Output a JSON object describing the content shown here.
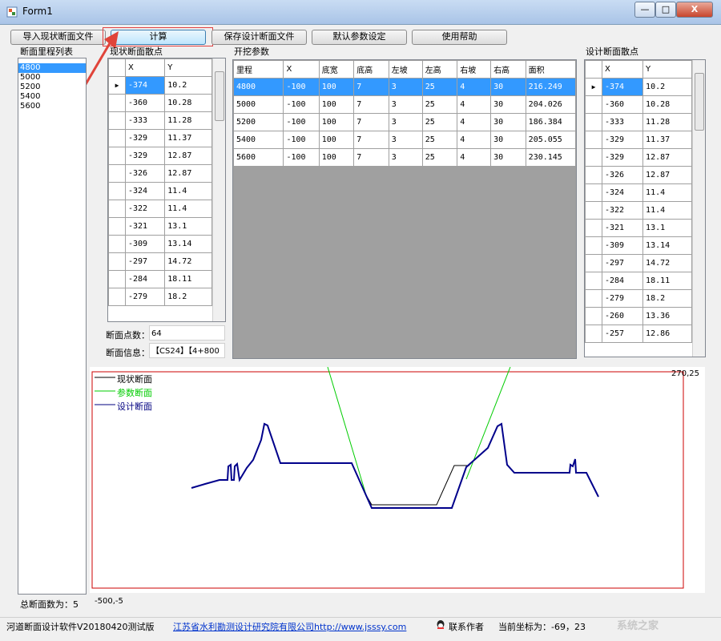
{
  "window": {
    "title": "Form1",
    "controls": {
      "minimize": "—",
      "maximize": "□",
      "close": "X"
    }
  },
  "toolbar": {
    "import_label": "导入现状断面文件",
    "compute_label": "计算",
    "save_label": "保存设计断面文件",
    "defaults_label": "默认参数设定",
    "help_label": "使用帮助"
  },
  "mileage_list": {
    "heading": "断面里程列表",
    "items": [
      "4800",
      "5000",
      "5200",
      "5400",
      "5600"
    ],
    "selected": "4800",
    "total_label": "总断面数为：5"
  },
  "current_points": {
    "heading": "现状断面散点",
    "columns": [
      "X",
      "Y"
    ],
    "rows": [
      [
        "-374",
        "10.2"
      ],
      [
        "-360",
        "10.28"
      ],
      [
        "-333",
        "11.28"
      ],
      [
        "-329",
        "11.37"
      ],
      [
        "-329",
        "12.87"
      ],
      [
        "-326",
        "12.87"
      ],
      [
        "-324",
        "11.4"
      ],
      [
        "-322",
        "11.4"
      ],
      [
        "-321",
        "13.1"
      ],
      [
        "-309",
        "13.14"
      ],
      [
        "-297",
        "14.72"
      ],
      [
        "-284",
        "18.11"
      ],
      [
        "-279",
        "18.2"
      ]
    ],
    "point_count_label": "断面点数：",
    "point_count": "64",
    "info_label": "断面信息：",
    "info_value": "【CS24】【4+800"
  },
  "excavation_params": {
    "heading": "开挖参数",
    "columns": [
      "里程",
      "X",
      "底宽",
      "底高",
      "左坡",
      "左高",
      "右坡",
      "右高",
      "面积"
    ],
    "rows": [
      [
        "4800",
        "-100",
        "100",
        "7",
        "3",
        "25",
        "4",
        "30",
        "216.249"
      ],
      [
        "5000",
        "-100",
        "100",
        "7",
        "3",
        "25",
        "4",
        "30",
        "204.026"
      ],
      [
        "5200",
        "-100",
        "100",
        "7",
        "3",
        "25",
        "4",
        "30",
        "186.384"
      ],
      [
        "5400",
        "-100",
        "100",
        "7",
        "3",
        "25",
        "4",
        "30",
        "205.055"
      ],
      [
        "5600",
        "-100",
        "100",
        "7",
        "3",
        "25",
        "4",
        "30",
        "230.145"
      ]
    ]
  },
  "design_points": {
    "heading": "设计断面散点",
    "columns": [
      "X",
      "Y"
    ],
    "rows": [
      [
        "-374",
        "10.2"
      ],
      [
        "-360",
        "10.28"
      ],
      [
        "-333",
        "11.28"
      ],
      [
        "-329",
        "11.37"
      ],
      [
        "-329",
        "12.87"
      ],
      [
        "-326",
        "12.87"
      ],
      [
        "-324",
        "11.4"
      ],
      [
        "-322",
        "11.4"
      ],
      [
        "-321",
        "13.1"
      ],
      [
        "-309",
        "13.14"
      ],
      [
        "-297",
        "14.72"
      ],
      [
        "-284",
        "18.11"
      ],
      [
        "-279",
        "18.2"
      ],
      [
        "-260",
        "13.36"
      ],
      [
        "-257",
        "12.86"
      ]
    ]
  },
  "plot": {
    "legend": [
      {
        "label": "现状断面",
        "color": "#000000"
      },
      {
        "label": "参数断面",
        "color": "#00cc00"
      },
      {
        "label": "设计断面",
        "color": "#000080"
      }
    ],
    "top_right_label": "270,25",
    "bottom_left_label": "-500,-5",
    "border_color": "#cc0000"
  },
  "statusbar": {
    "app_version": "河道断面设计软件V20180420测试版",
    "org_link": "江苏省水利勘测设计研究院有限公司http://www.jsssy.com",
    "contact": "联系作者",
    "coord_label": "当前坐标为：-69，23"
  },
  "watermark": "系统之家"
}
